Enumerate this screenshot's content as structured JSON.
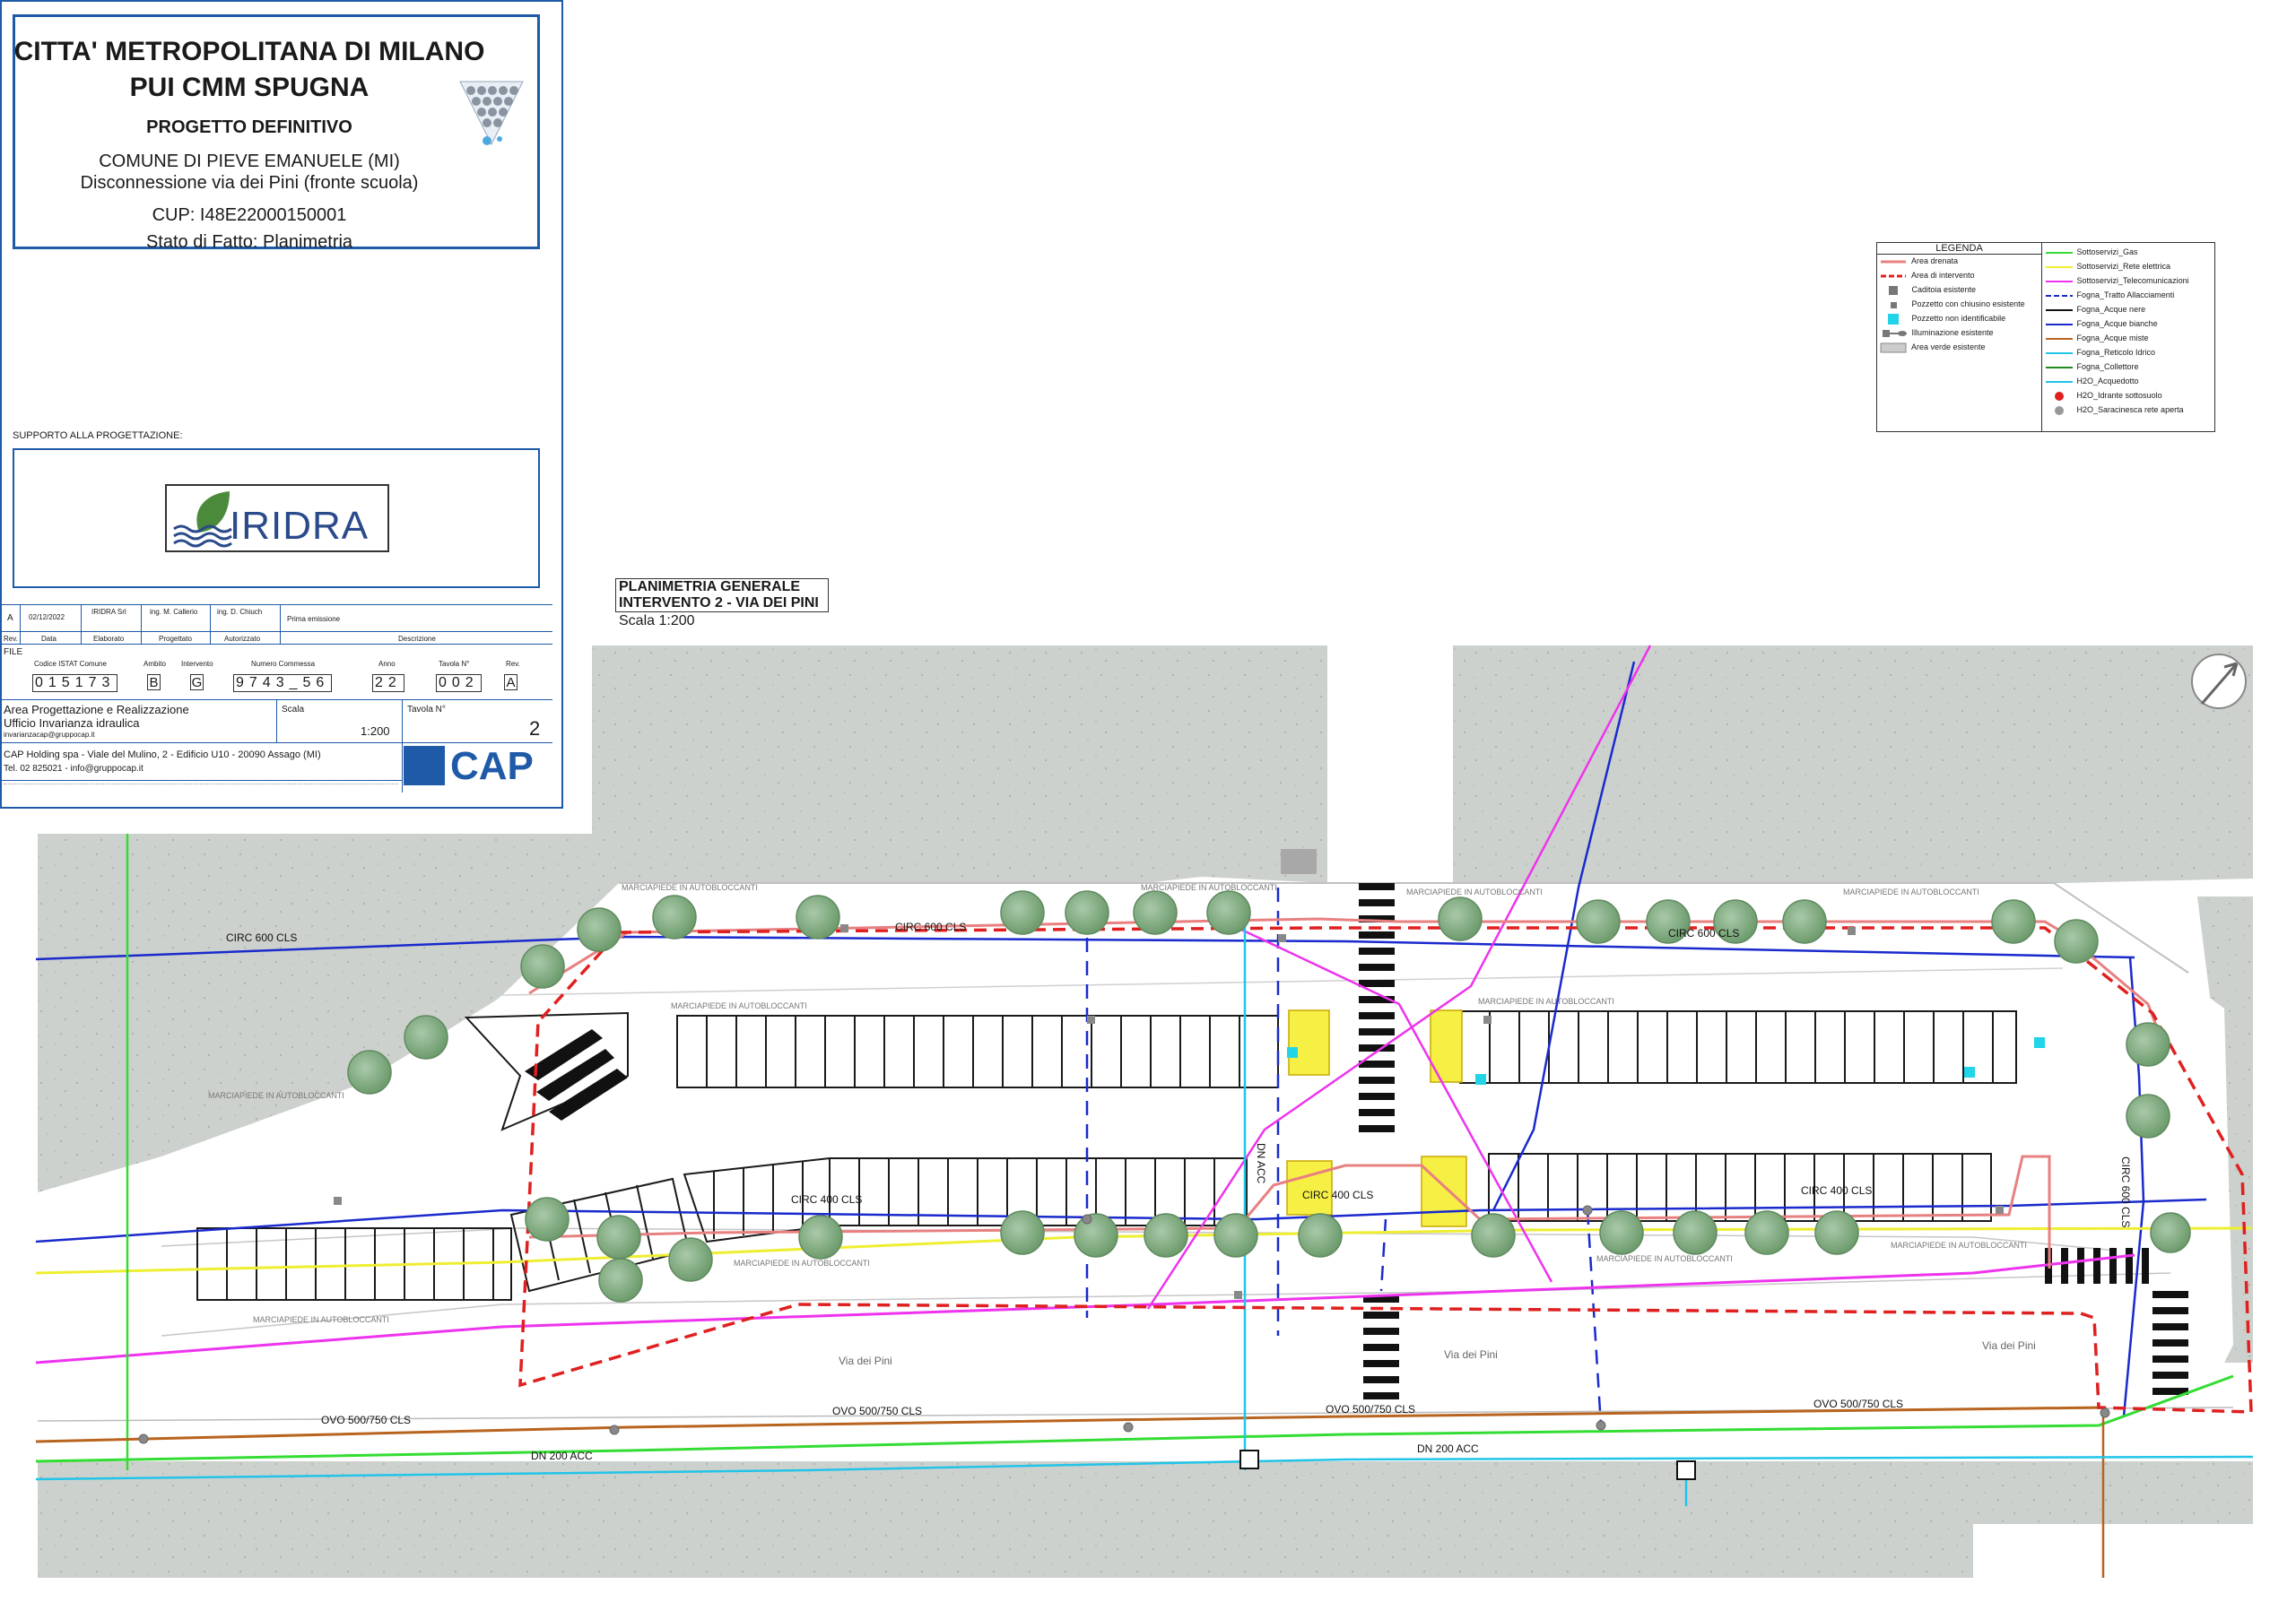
{
  "title_block": {
    "client": "CITTA' METROPOLITANA DI MILANO",
    "project": "PUI CMM SPUGNA",
    "phase": "PROGETTO DEFINITIVO",
    "municipality": "COMUNE DI PIEVE EMANUELE (MI)",
    "intervention": "Disconnessione via dei Pini (fronte scuola)",
    "cup": "CUP: I48E22000150001",
    "drawing": "Stato di Fatto: Planimetria",
    "support_label": "SUPPORTO ALLA PROGETTAZIONE:",
    "support_logo": "IRIDRA",
    "revision_row": {
      "rev": "A",
      "date": "02/12/2022",
      "elaborato": "IRIDRA Srl",
      "progettato": "ing. M. Callerio",
      "autorizzato": "ing. D. Chiuch",
      "descrizione": "Prima emissione"
    },
    "revision_headers": [
      "Rev.",
      "Data",
      "Elaborato",
      "Progettato",
      "Autorizzato",
      "Descrizione"
    ],
    "file_label": "FILE",
    "code_headers": [
      "Codice ISTAT Comune",
      "Ambito",
      "Intervento",
      "Numero Commessa",
      "Anno",
      "Tavola N°",
      "Rev."
    ],
    "code_istat": "015173",
    "code_ambito": "B",
    "code_intervento": "G",
    "code_commessa": "9743_56",
    "code_anno": "22",
    "code_tavola": "002",
    "code_rev": "A",
    "area_line1": "Area Progettazione e Realizzazione",
    "area_line2": "Ufficio Invarianza idraulica",
    "area_email": "invarianzacap@gruppocap.it",
    "scala_label": "Scala",
    "scala_value": "1:200",
    "tavola_label": "Tavola N°",
    "tavola_value": "2",
    "company_address": "CAP Holding spa - Viale del Mulino, 2 - Edificio U10 - 20090 Assago (MI)",
    "company_contacts": "Tel. 02 825021 - info@gruppocap.it",
    "company_logo": "CAP"
  },
  "legend": {
    "title": "LEGENDA",
    "left": [
      {
        "label": "Area drenata",
        "color": "#e88080",
        "style": "solid"
      },
      {
        "label": "Area di intervento",
        "color": "#e02020",
        "style": "dashed"
      },
      {
        "label": "Caditoia esistente",
        "color": "#777777",
        "style": "square"
      },
      {
        "label": "Pozzetto con chiusino esistente",
        "color": "#777777",
        "style": "square-small"
      },
      {
        "label": "Pozzetto non identificabile",
        "color": "#22d4e8",
        "style": "square"
      },
      {
        "label": "Illuminazione esistente",
        "color": "#777777",
        "style": "lamp"
      },
      {
        "label": "Area verde esistente",
        "color": "#cccccc",
        "style": "box"
      }
    ],
    "right": [
      {
        "label": "Sottoservizi_Gas",
        "color": "#33dd33",
        "style": "solid"
      },
      {
        "label": "Sottoservizi_Rete elettrica",
        "color": "#eeee33",
        "style": "solid"
      },
      {
        "label": "Sottoservizi_Telecomunicazioni",
        "color": "#ee33ee",
        "style": "solid"
      },
      {
        "label": "Fogna_Tratto Allacciamenti",
        "color": "#1a2acc",
        "style": "dashed"
      },
      {
        "label": "Fogna_Acque nere",
        "color": "#111111",
        "style": "solid"
      },
      {
        "label": "Fogna_Acque bianche",
        "color": "#1a2acc",
        "style": "solid"
      },
      {
        "label": "Fogna_Acque miste",
        "color": "#b8641e",
        "style": "solid"
      },
      {
        "label": "Fogna_Reticolo Idrico",
        "color": "#22c4e8",
        "style": "solid"
      },
      {
        "label": "Fogna_Collettore",
        "color": "#228822",
        "style": "solid"
      },
      {
        "label": "H2O_Acquedotto",
        "color": "#22c4e8",
        "style": "solid"
      },
      {
        "label": "H2O_Idrante sottosuolo",
        "color": "#e02020",
        "style": "dot"
      },
      {
        "label": "H2O_Saracinesca rete aperta",
        "color": "#999999",
        "style": "dot"
      }
    ]
  },
  "plan": {
    "title_line1": "PLANIMETRIA GENERALE",
    "title_line2": "INTERVENTO 2 - VIA DEI PINI",
    "scale": "Scala 1:200",
    "labels": {
      "circ600_a": "CIRC 600 CLS",
      "circ600_b": "CIRC 600 CLS",
      "circ600_c": "CIRC 600 CLS",
      "circ600_v": "CIRC 600 CLS",
      "circ400_a": "CIRC 400 CLS",
      "circ400_b": "CIRC 400 CLS",
      "circ400_c": "CIRC 400 CLS",
      "ovo_a": "OVO 500/750 CLS",
      "ovo_b": "OVO 500/750 CLS",
      "ovo_c": "OVO 500/750 CLS",
      "ovo_d": "OVO 500/750 CLS",
      "dn_a": "DN 200 ACC",
      "dn_b": "DN 200 ACC",
      "dn_v": "DN ACC",
      "street_a": "Via dei Pini",
      "street_b": "Via dei Pini",
      "street_c": "Via dei Pini",
      "sidewalk_1": "MARCIAPIEDE IN AUTOBLOCCANTI",
      "sidewalk_2": "MARCIAPIEDE IN AUTOBLOCCANTI",
      "sidewalk_3": "MARCIAPIEDE IN AUTOBLOCCANTI",
      "sidewalk_4": "MARCIAPIEDE IN AUTOBLOCCANTI",
      "sidewalk_5": "MARCIAPIEDE IN AUTOBLOCCANTI",
      "sidewalk_6": "MARCIAPIEDE IN AUTOBLOCCANTI",
      "sidewalk_7": "MARCIAPIEDE IN AUTOBLOCCANTI",
      "sidewalk_8": "MARCIAPIEDE IN AUTOBLOCCANTI",
      "sidewalk_9": "MARCIAPIEDE IN AUTOBLOCCANTI",
      "sidewalk_10": "MARCIAPIEDE IN AUTOBLOCCANTI",
      "sidewalk_11": "MARCIAPIEDE IN AUTOBLOCCANTI"
    }
  },
  "colors": {
    "frame": "#1e5aa8",
    "green_area": "#cfd3cf",
    "intervention": "#e02020",
    "drained": "#e88080",
    "sewer_white": "#1a2acc",
    "gas": "#33dd33",
    "power": "#eeee33",
    "telecom": "#ee33ee",
    "water": "#22c4e8",
    "mixed": "#b8641e",
    "tree": "#7fae7f"
  }
}
